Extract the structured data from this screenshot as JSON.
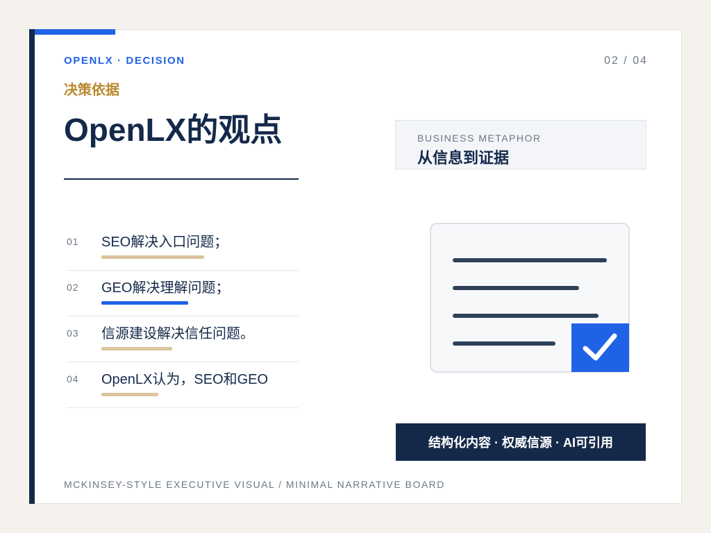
{
  "header": {
    "eyebrow": "OPENLX · DECISION",
    "page_indicator": "02 / 04",
    "kicker": "决策依据",
    "title": "OpenLX的观点"
  },
  "points": [
    {
      "num": "01",
      "text": "SEO解决入口问题；",
      "accent": "#dbc59f",
      "bar_fraction": 0.58
    },
    {
      "num": "02",
      "text": "GEO解决理解问题；",
      "accent": "#1f62e6",
      "bar_fraction": 0.49
    },
    {
      "num": "03",
      "text": "信源建设解决信任问题。",
      "accent": "#dbc59f",
      "bar_fraction": 0.4
    },
    {
      "num": "04",
      "text": "OpenLX认为，SEO和GEO",
      "accent": "#dbc59f",
      "bar_fraction": 0.32
    }
  ],
  "metaphor": {
    "label": "BUSINESS METAPHOR",
    "value": "从信息到证据"
  },
  "illustration": {
    "document_icon": "document-icon",
    "check_icon": "check-icon",
    "accent": "#1f62e6"
  },
  "tagline": "结构化内容 · 权威信源 · AI可引用",
  "footer": "MCKINSEY-STYLE EXECUTIVE VISUAL / MINIMAL NARRATIVE BOARD",
  "colors": {
    "navy": "#14294a",
    "blue": "#1f62e6",
    "gold": "#b8892f"
  }
}
